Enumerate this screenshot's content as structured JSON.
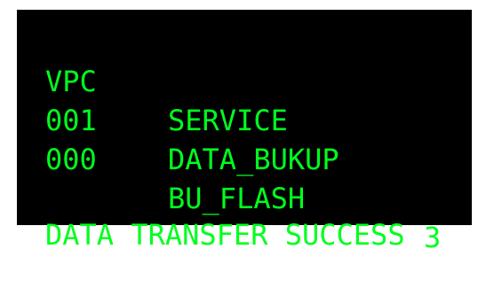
{
  "header": {
    "col_vpc": "VPC",
    "col_service": "SERVICE"
  },
  "rows": [
    {
      "vpc": "001",
      "service": "DATA_BUKUP",
      "count": ""
    },
    {
      "vpc": "000",
      "service": "BU_FLASH",
      "count": "3"
    }
  ],
  "status": {
    "message": "DATA TRANSFER SUCCESS"
  },
  "colors": {
    "screen_background": "#000000",
    "text": "#00ff1e",
    "page_background": "#ffffff"
  }
}
